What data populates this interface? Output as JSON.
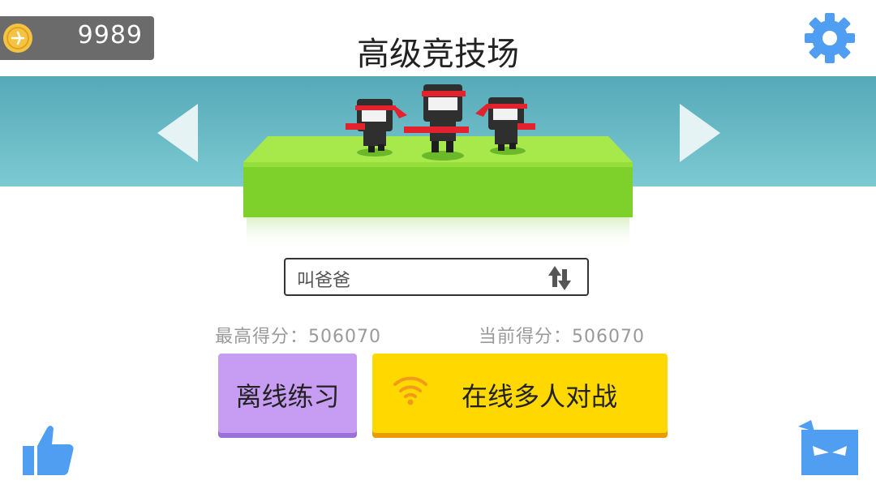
{
  "wallet": {
    "coins": "9989",
    "coin_icon": "coin-icon"
  },
  "header": {
    "title": "高级竞技场",
    "settings_icon": "gear-icon"
  },
  "arena": {
    "prev_icon": "chevron-left-icon",
    "next_icon": "chevron-right-icon",
    "characters": [
      "ninja",
      "ninja",
      "ninja"
    ]
  },
  "player": {
    "name": "叫爸爸",
    "swap_icon": "swap-arrows-icon"
  },
  "scores": {
    "best": "最高得分：506070",
    "current": "当前得分：506070"
  },
  "buttons": {
    "offline": "离线练习",
    "online": "在线多人对战"
  },
  "footer": {
    "like_icon": "thumbs-up-icon",
    "ninja_icon": "ninja-face-icon"
  },
  "colors": {
    "banner": "#6cbcc7",
    "settings": "#4f9ef2",
    "offline_button": "#c79cf3",
    "online_button": "#ffd800",
    "wifi": "#f29b1a",
    "grass": "#8fe03a"
  }
}
